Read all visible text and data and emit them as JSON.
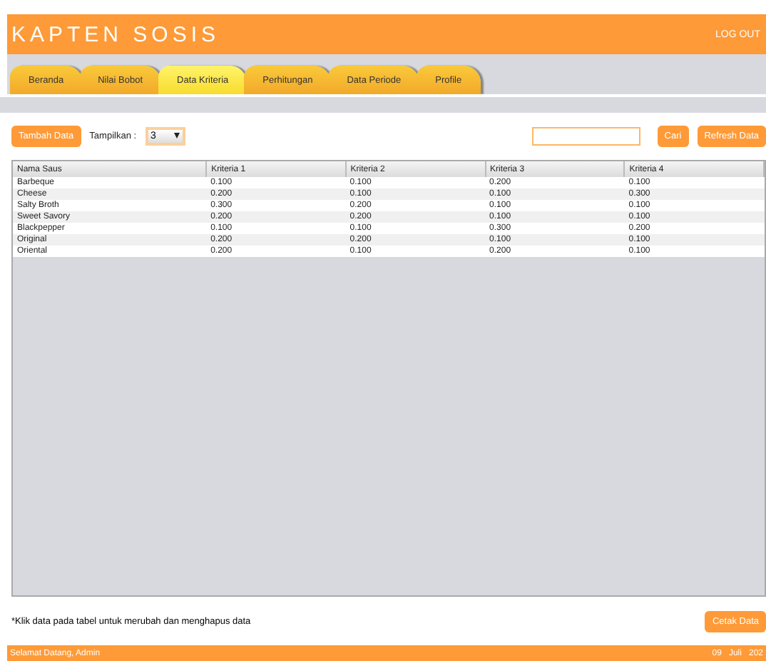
{
  "header": {
    "title": "KAPTEN SOSIS",
    "logout": "LOG OUT"
  },
  "tabs": [
    {
      "label": "Beranda",
      "selected": false
    },
    {
      "label": "Nilai Bobot",
      "selected": false
    },
    {
      "label": "Data Kriteria",
      "selected": true
    },
    {
      "label": "Perhitungan",
      "selected": false
    },
    {
      "label": "Data Periode",
      "selected": false
    },
    {
      "label": "Profile",
      "selected": false
    }
  ],
  "toolbar": {
    "add_button": "Tambah Data",
    "show_label": "Tampilkan :",
    "show_value": "3",
    "search_button": "Cari",
    "refresh_button": "Refresh Data"
  },
  "table": {
    "columns": [
      "Nama Saus",
      "Kriteria 1",
      "Kriteria 2",
      "Kriteria 3",
      "Kriteria 4"
    ],
    "rows": [
      [
        "Barbeque",
        "0.100",
        "0.100",
        "0.200",
        "0.100"
      ],
      [
        "Cheese",
        "0.200",
        "0.100",
        "0.100",
        "0.300"
      ],
      [
        "Salty Broth",
        "0.300",
        "0.200",
        "0.100",
        "0.100"
      ],
      [
        "Sweet Savory",
        "0.200",
        "0.200",
        "0.100",
        "0.100"
      ],
      [
        "Blackpepper",
        "0.100",
        "0.100",
        "0.300",
        "0.200"
      ],
      [
        "Original",
        "0.200",
        "0.200",
        "0.100",
        "0.100"
      ],
      [
        "Oriental",
        "0.200",
        "0.100",
        "0.200",
        "0.100"
      ]
    ]
  },
  "note": "*Klik data pada tabel untuk merubah dan menghapus data",
  "print_button": "Cetak Data",
  "status_bar": {
    "greeting": "Selamat Datang, Admin",
    "date": "09   Juli   202"
  }
}
